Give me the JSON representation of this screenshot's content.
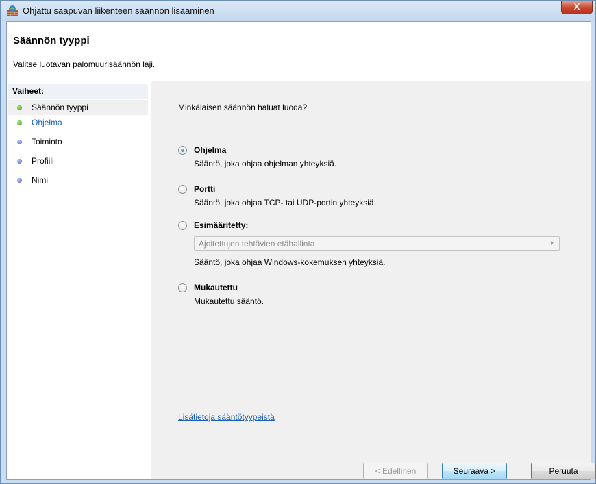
{
  "window": {
    "title": "Ohjattu saapuvan liikenteen säännön lisääminen",
    "close_label": "X"
  },
  "header": {
    "title": "Säännön tyyppi",
    "subtitle": "Valitse luotavan palomuurisäännön laji."
  },
  "steps": {
    "heading": "Vaiheet:",
    "items": [
      {
        "label": "Säännön tyyppi",
        "state": "current",
        "dot": "green"
      },
      {
        "label": "Ohjelma",
        "state": "link",
        "dot": "green"
      },
      {
        "label": "Toiminto",
        "state": "pending",
        "dot": "blue"
      },
      {
        "label": "Profiili",
        "state": "pending",
        "dot": "blue"
      },
      {
        "label": "Nimi",
        "state": "pending",
        "dot": "blue"
      }
    ]
  },
  "main": {
    "question": "Minkälaisen säännön haluat luoda?",
    "options": [
      {
        "label": "Ohjelma",
        "desc": "Sääntö, joka ohjaa ohjelman yhteyksiä.",
        "checked": true
      },
      {
        "label": "Portti",
        "desc": "Sääntö, joka ohjaa TCP- tai UDP-portin yhteyksiä.",
        "checked": false
      },
      {
        "label": "Esimääritetty:",
        "desc": "Sääntö, joka ohjaa Windows-kokemuksen yhteyksiä.",
        "checked": false
      },
      {
        "label": "Mukautettu",
        "desc": "Mukautettu sääntö.",
        "checked": false
      }
    ],
    "predefined_select": "Ajoitettujen tehtävien etähallinta",
    "help_link": "Lisätietoja sääntötyypeistä"
  },
  "buttons": {
    "back": "< Edellinen",
    "next": "Seuraava >",
    "cancel": "Peruuta"
  },
  "colors": {
    "link": "#1a5fb4",
    "pane_background": "#f0f0f0",
    "title_bar": "#c9dcf0"
  },
  "icons": {
    "app": "firewall-icon",
    "close": "close-icon",
    "dropdown": "chevron-down-icon"
  }
}
